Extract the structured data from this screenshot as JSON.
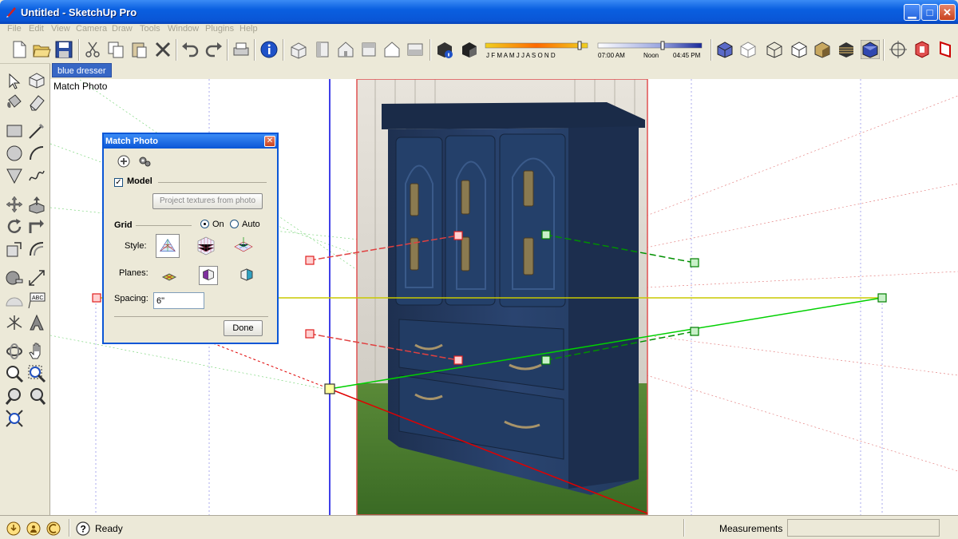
{
  "window": {
    "title": "Untitled - SketchUp Pro",
    "controls": [
      "minimize",
      "maximize",
      "close"
    ]
  },
  "menu": [
    "File",
    "Edit",
    "View",
    "Camera",
    "Draw",
    "Tools",
    "Window",
    "Plugins",
    "Help"
  ],
  "shadow_settings": {
    "months": "J F M A M J J A S O N D",
    "time_start": "07:00 AM",
    "time_mid": "Noon",
    "time_end": "04:45 PM"
  },
  "scene_tab": "blue dresser",
  "viewport": {
    "label": "Match Photo"
  },
  "dialog": {
    "title": "Match Photo",
    "model_label": "Model",
    "model_checked": true,
    "project_button": "Project textures from photo",
    "grid_label": "Grid",
    "grid_on": "On",
    "grid_auto": "Auto",
    "grid_selected": "On",
    "style_label": "Style:",
    "planes_label": "Planes:",
    "spacing_label": "Spacing:",
    "spacing_value": "6\"",
    "done_button": "Done"
  },
  "status": {
    "text": "Ready",
    "measurements_label": "Measurements",
    "measurements_value": ""
  },
  "colors": {
    "title_bar": "#0a56d6",
    "red_axis": "#e00000",
    "green_axis": "#00c000",
    "blue_axis": "#0000e0",
    "horizon": "#c8c800"
  }
}
